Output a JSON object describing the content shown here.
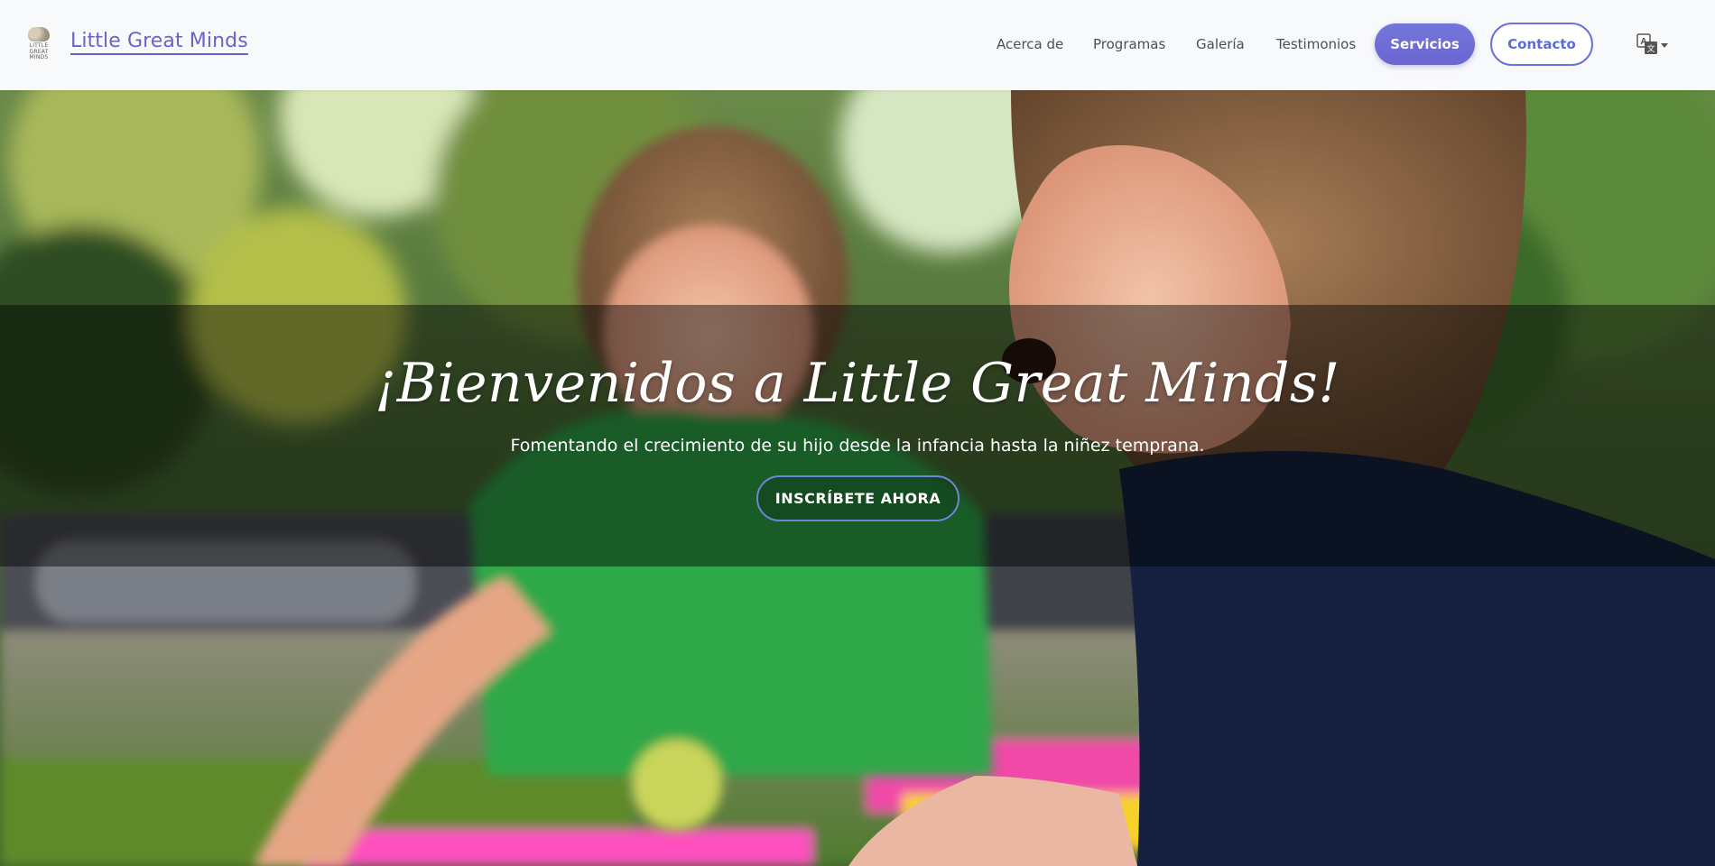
{
  "header": {
    "logo": {
      "text_lines": [
        "LITTLE",
        "GREAT",
        "MINDS"
      ],
      "icon": "brain-logo"
    },
    "brand": "Little Great Minds",
    "nav": [
      {
        "label": "Acerca de"
      },
      {
        "label": "Programas"
      },
      {
        "label": "Galería"
      },
      {
        "label": "Testimonios"
      }
    ],
    "services_button": "Servicios",
    "contact_button": "Contacto",
    "language_icon": "translate-icon"
  },
  "hero": {
    "title": "¡Bienvenidos a Little Great Minds!",
    "subtitle": "Fomentando el crecimiento de su hijo desde la infancia hasta la niñez temprana.",
    "cta": "INSCRÍBETE AHORA",
    "image": "two-children-playing-outdoors"
  },
  "colors": {
    "brand": "#6a63c7",
    "services_bg": "#6f71d6",
    "contact_border": "#6a73d6",
    "cta_border": "#6e86d8"
  }
}
